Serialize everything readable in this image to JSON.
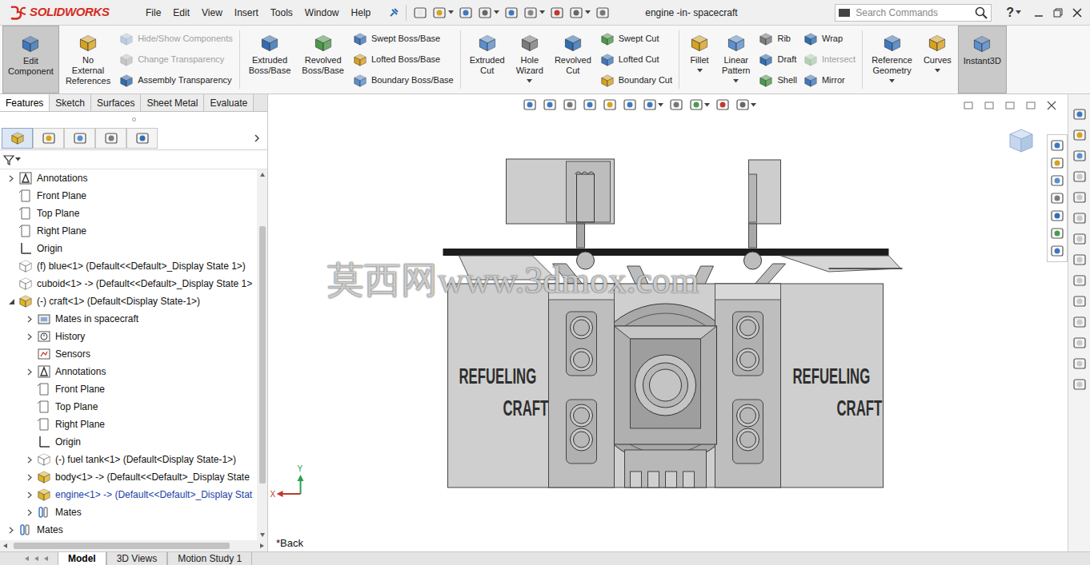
{
  "app": {
    "logo": "SOLIDWORKS"
  },
  "menu": [
    "File",
    "Edit",
    "View",
    "Insert",
    "Tools",
    "Window",
    "Help"
  ],
  "window": {
    "title": "engine -in- spacecraft"
  },
  "search": {
    "placeholder": "Search Commands"
  },
  "help": "?",
  "ribbon": [
    {
      "kind": "large",
      "label": "Edit Component",
      "active": true,
      "dropdown": false
    },
    {
      "kind": "large",
      "label": "No External References",
      "active": false,
      "dropdown": false
    },
    {
      "kind": "stack",
      "items": [
        {
          "label": "Hide/Show Components",
          "disabled": true
        },
        {
          "label": "Change Transparency",
          "disabled": true
        },
        {
          "label": "Assembly Transparency",
          "disabled": false
        }
      ]
    },
    {
      "kind": "divider"
    },
    {
      "kind": "large",
      "label": "Extruded Boss/Base",
      "active": false,
      "dropdown": false
    },
    {
      "kind": "large",
      "label": "Revolved Boss/Base",
      "active": false,
      "dropdown": false
    },
    {
      "kind": "stack",
      "items": [
        {
          "label": "Swept Boss/Base",
          "disabled": false
        },
        {
          "label": "Lofted Boss/Base",
          "disabled": false
        },
        {
          "label": "Boundary Boss/Base",
          "disabled": false
        }
      ]
    },
    {
      "kind": "divider"
    },
    {
      "kind": "large",
      "label": "Extruded Cut",
      "active": false,
      "dropdown": false
    },
    {
      "kind": "large",
      "label": "Hole Wizard",
      "active": false,
      "dropdown": true
    },
    {
      "kind": "large",
      "label": "Revolved Cut",
      "active": false,
      "dropdown": false
    },
    {
      "kind": "stack",
      "items": [
        {
          "label": "Swept Cut",
          "disabled": false
        },
        {
          "label": "Lofted Cut",
          "disabled": false
        },
        {
          "label": "Boundary Cut",
          "disabled": false
        }
      ]
    },
    {
      "kind": "divider"
    },
    {
      "kind": "large",
      "label": "Fillet",
      "active": false,
      "dropdown": true
    },
    {
      "kind": "large",
      "label": "Linear Pattern",
      "active": false,
      "dropdown": true
    },
    {
      "kind": "stack",
      "items": [
        {
          "label": "Rib",
          "disabled": false
        },
        {
          "label": "Draft",
          "disabled": false
        },
        {
          "label": "Shell",
          "disabled": false
        }
      ]
    },
    {
      "kind": "stack",
      "items": [
        {
          "label": "Wrap",
          "disabled": false
        },
        {
          "label": "Intersect",
          "disabled": true
        },
        {
          "label": "Mirror",
          "disabled": false
        }
      ]
    },
    {
      "kind": "divider"
    },
    {
      "kind": "large",
      "label": "Reference Geometry",
      "active": false,
      "dropdown": true
    },
    {
      "kind": "large",
      "label": "Curves",
      "active": false,
      "dropdown": true
    },
    {
      "kind": "large",
      "label": "Instant3D",
      "active": true,
      "dropdown": false
    }
  ],
  "feature_tabs": [
    {
      "label": "Features",
      "selected": true
    },
    {
      "label": "Sketch",
      "selected": false
    },
    {
      "label": "Surfaces",
      "selected": false
    },
    {
      "label": "Sheet Metal",
      "selected": false
    },
    {
      "label": "Evaluate",
      "selected": false
    }
  ],
  "panel_tabs": [
    {
      "selected": true
    },
    {
      "selected": false
    },
    {
      "selected": false
    },
    {
      "selected": false
    },
    {
      "selected": false
    }
  ],
  "tree": [
    {
      "label": "Annotations",
      "level": 0,
      "kind": "annotations",
      "expandable": true,
      "expanded": false,
      "highlighted": false
    },
    {
      "label": "Front Plane",
      "level": 0,
      "kind": "plane",
      "expandable": false,
      "expanded": false,
      "highlighted": false
    },
    {
      "label": "Top Plane",
      "level": 0,
      "kind": "plane",
      "expandable": false,
      "expanded": false,
      "highlighted": false
    },
    {
      "label": "Right Plane",
      "level": 0,
      "kind": "plane",
      "expandable": false,
      "expanded": false,
      "highlighted": false
    },
    {
      "label": "Origin",
      "level": 0,
      "kind": "origin",
      "expandable": false,
      "expanded": false,
      "highlighted": false
    },
    {
      "label": "(f) blue<1> (Default<<Default>_Display State 1>)",
      "level": 0,
      "kind": "part",
      "expandable": false,
      "expanded": false,
      "highlighted": false
    },
    {
      "label": "cuboid<1> -> (Default<<Default>_Display State 1>",
      "level": 0,
      "kind": "part",
      "expandable": false,
      "expanded": false,
      "highlighted": false
    },
    {
      "label": "(-) craft<1> (Default<Display State-1>)",
      "level": 0,
      "kind": "assembly",
      "expandable": true,
      "expanded": true,
      "highlighted": false
    },
    {
      "label": "Mates in spacecraft",
      "level": 1,
      "kind": "folder",
      "expandable": true,
      "expanded": false,
      "highlighted": false
    },
    {
      "label": "History",
      "level": 1,
      "kind": "history",
      "expandable": true,
      "expanded": false,
      "highlighted": false
    },
    {
      "label": "Sensors",
      "level": 1,
      "kind": "sensors",
      "expandable": false,
      "expanded": false,
      "highlighted": false
    },
    {
      "label": "Annotations",
      "level": 1,
      "kind": "annotations",
      "expandable": true,
      "expanded": false,
      "highlighted": false
    },
    {
      "label": "Front Plane",
      "level": 1,
      "kind": "plane",
      "expandable": false,
      "expanded": false,
      "highlighted": false
    },
    {
      "label": "Top Plane",
      "level": 1,
      "kind": "plane",
      "expandable": false,
      "expanded": false,
      "highlighted": false
    },
    {
      "label": "Right Plane",
      "level": 1,
      "kind": "plane",
      "expandable": false,
      "expanded": false,
      "highlighted": false
    },
    {
      "label": "Origin",
      "level": 1,
      "kind": "origin",
      "expandable": false,
      "expanded": false,
      "highlighted": false
    },
    {
      "label": "(-) fuel tank<1> (Default<Display State-1>)",
      "level": 1,
      "kind": "part",
      "expandable": true,
      "expanded": false,
      "highlighted": false
    },
    {
      "label": "body<1> -> (Default<<Default>_Display State",
      "level": 1,
      "kind": "assembly",
      "expandable": true,
      "expanded": false,
      "highlighted": false
    },
    {
      "label": "engine<1> -> (Default<<Default>_Display Stat",
      "level": 1,
      "kind": "assembly",
      "expandable": true,
      "expanded": false,
      "highlighted": true
    },
    {
      "label": "Mates",
      "level": 1,
      "kind": "mates",
      "expandable": true,
      "expanded": false,
      "highlighted": false
    },
    {
      "label": "Mates",
      "level": 0,
      "kind": "mates",
      "expandable": true,
      "expanded": false,
      "highlighted": false
    }
  ],
  "viewport": {
    "watermark": "莫西网www.3dmox.com",
    "model_labels": [
      {
        "line1": "REFUELING",
        "line2": "CRAFT"
      },
      {
        "line1": "REFUELING",
        "line2": "CRAFT"
      }
    ],
    "view_name": "*Back",
    "triad": {
      "x": "X",
      "y": "Y"
    }
  },
  "bottom_tabs": [
    {
      "label": "Model",
      "selected": true
    },
    {
      "label": "3D Views",
      "selected": false
    },
    {
      "label": "Motion Study 1",
      "selected": false
    }
  ]
}
